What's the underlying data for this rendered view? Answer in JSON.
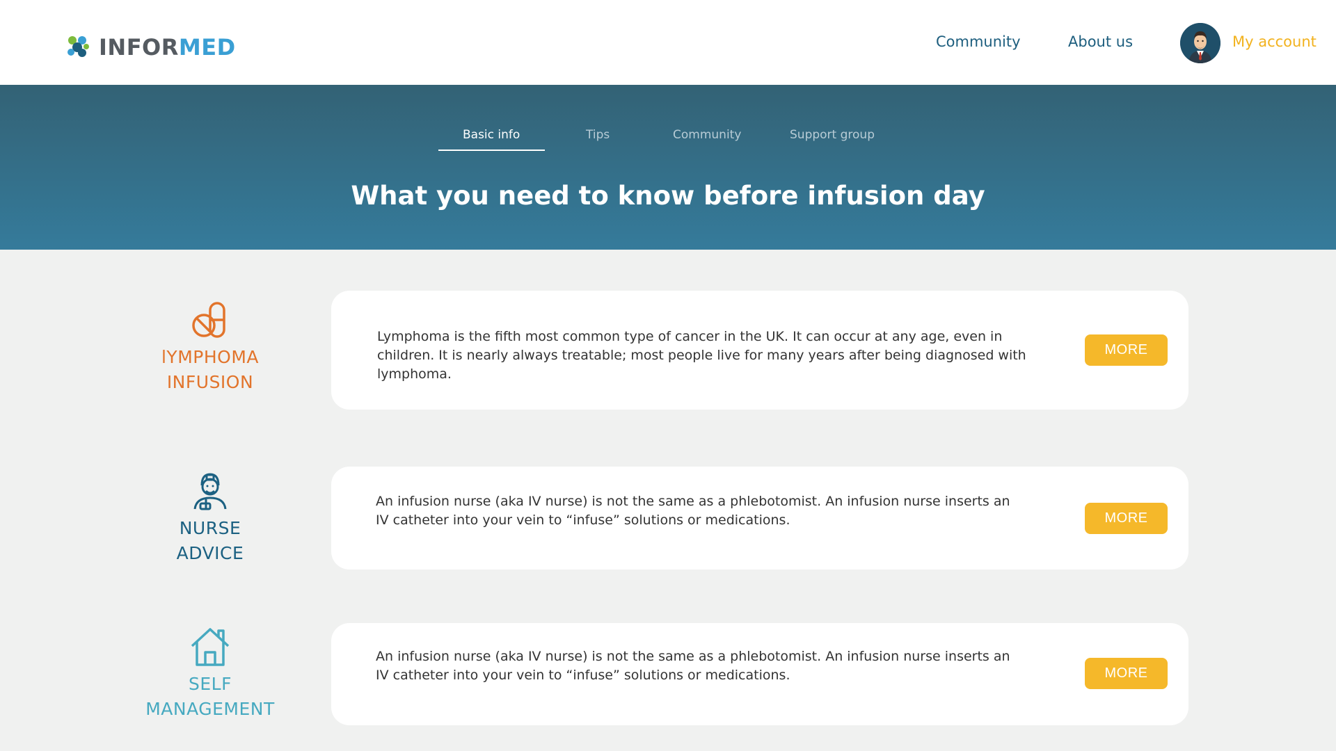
{
  "header": {
    "logo_part1": "INFOR",
    "logo_part2": "MED",
    "nav": {
      "community": "Community",
      "about": "About us"
    },
    "account": "My account"
  },
  "banner": {
    "tabs": [
      "Basic info",
      "Tips",
      "Community",
      "Support group"
    ],
    "active_tab": "Basic info",
    "title": "What you need to know before infusion day"
  },
  "cards": [
    {
      "label_line1": "lYMPHOMA",
      "label_line2": "INFUSION",
      "icon": "pill-icon",
      "text": "Lymphoma is the fifth most common type of cancer in the UK. It can occur at any age, even in children. It is nearly always treatable; most people live for many years after being diagnosed with lymphoma.",
      "button": "MORE"
    },
    {
      "label_line1": "NURSE",
      "label_line2": "ADVICE",
      "icon": "nurse-icon",
      "text": "An infusion nurse (aka IV nurse) is not the same as a phlebotomist. An infusion nurse inserts an IV catheter into your vein to “infuse” solutions or medications.",
      "button": "MORE"
    },
    {
      "label_line1": "SELF",
      "label_line2": "MANAGEMENT",
      "icon": "home-icon",
      "text": "An infusion nurse (aka IV nurse) is not the same as a phlebotomist. An infusion nurse inserts an IV catheter into your vein to “infuse” solutions or medications.",
      "button": "MORE"
    }
  ],
  "colors": {
    "accent": "#f5b82a",
    "brand_blue": "#3a9fd4",
    "navy": "#1c6182",
    "orange": "#e2742b",
    "teal": "#46a9c0"
  }
}
